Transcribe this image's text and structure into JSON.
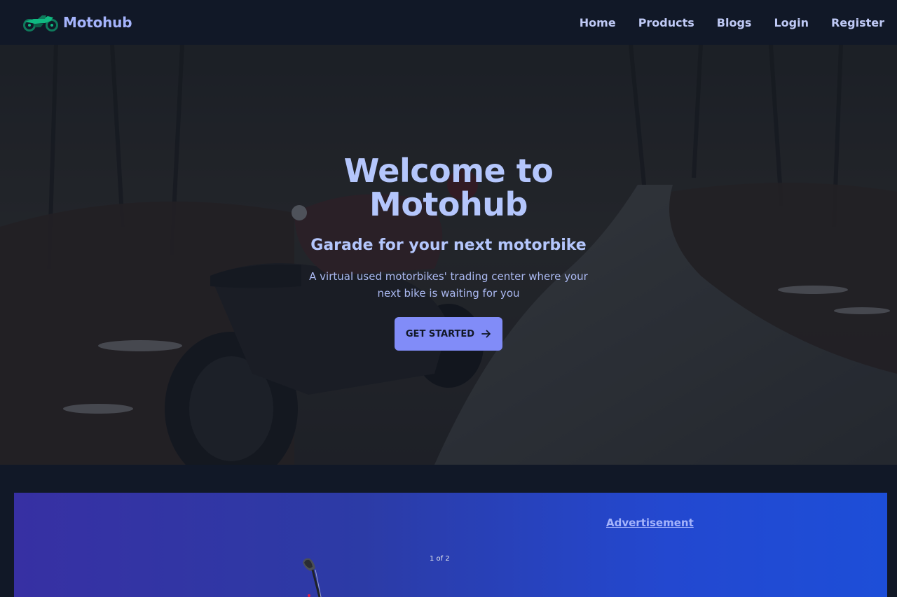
{
  "navbar": {
    "brand_name": "Motohub",
    "logo_icon": "motorcycle-icon",
    "links": [
      {
        "label": "Home"
      },
      {
        "label": "Products"
      },
      {
        "label": "Blogs"
      },
      {
        "label": "Login"
      },
      {
        "label": "Register"
      }
    ]
  },
  "hero": {
    "title": "Welcome to Motohub",
    "subtitle": "Garade for your next motorbike",
    "description": "A virtual used motorbikes' trading center where your next bike is waiting for you",
    "cta_label": "GET STARTED",
    "cta_icon": "arrow-right-icon",
    "background": "motorcycle-on-forest-road-photo"
  },
  "advertisement": {
    "title": "Advertisement",
    "slide_counter": "1 of 2"
  },
  "colors": {
    "page_bg": "#111827",
    "accent": "#818cf8",
    "text": "#a5b4fc",
    "logo": "#10b981",
    "ad_gradient_start": "#3730a3",
    "ad_gradient_end": "#1d4ed8"
  }
}
